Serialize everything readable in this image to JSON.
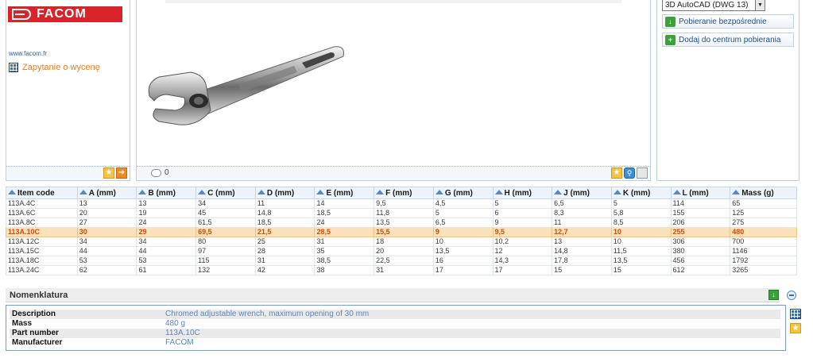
{
  "brand": {
    "logo_text": "FACOM",
    "site_link": "www.facom.fr",
    "quote_link": "Zapytanie o wycenę"
  },
  "colors": {
    "accent": "#d8232a",
    "link": "#2a5aa8",
    "quote": "#ef7c1c",
    "selected_row_bg": "#fbe2b8",
    "selected_row_text": "#d84a00",
    "value_text": "#5a87bd"
  },
  "preview": {
    "comment_count": "0"
  },
  "download": {
    "format_selected": "3D AutoCAD (DWG 13)",
    "direct_download": "Pobieranie bezpośrednie",
    "add_to_center": "Dodaj do centrum pobierania"
  },
  "table": {
    "headers": [
      "Item code",
      "A (mm)",
      "B (mm)",
      "C (mm)",
      "D (mm)",
      "E (mm)",
      "F (mm)",
      "G (mm)",
      "H (mm)",
      "J (mm)",
      "K (mm)",
      "L (mm)",
      "Mass (g)"
    ],
    "rows": [
      [
        "113A.4C",
        "13",
        "13",
        "34",
        "11",
        "14",
        "9,5",
        "4,5",
        "5",
        "6,5",
        "5",
        "114",
        "65"
      ],
      [
        "113A.6C",
        "20",
        "19",
        "45",
        "14,8",
        "18,5",
        "11,8",
        "5",
        "6",
        "8,3",
        "5,8",
        "155",
        "125"
      ],
      [
        "113A.8C",
        "27",
        "24",
        "61,5",
        "18,5",
        "24",
        "13,5",
        "6,5",
        "9",
        "11",
        "8,5",
        "206",
        "275"
      ],
      [
        "113A.10C",
        "30",
        "29",
        "69,5",
        "21,5",
        "28,5",
        "15,5",
        "9",
        "9,5",
        "12,7",
        "10",
        "255",
        "480"
      ],
      [
        "113A.12C",
        "34",
        "34",
        "80",
        "25",
        "31",
        "18",
        "10",
        "10,2",
        "13",
        "10",
        "306",
        "700"
      ],
      [
        "113A.15C",
        "44",
        "44",
        "97",
        "28",
        "35",
        "20",
        "13,5",
        "12",
        "14,8",
        "11,5",
        "380",
        "1146"
      ],
      [
        "113A.18C",
        "53",
        "53",
        "115",
        "31",
        "38,5",
        "22,5",
        "16",
        "14,3",
        "17,8",
        "13,5",
        "456",
        "1792"
      ],
      [
        "113A.24C",
        "62",
        "61",
        "132",
        "42",
        "38",
        "31",
        "17",
        "17",
        "15",
        "15",
        "612",
        "3265"
      ]
    ],
    "selected_row": 3
  },
  "nomenclature": {
    "title": "Nomenklatura",
    "rows": [
      {
        "key": "Description",
        "value": "Chromed adjustable wrench, maximum opening of 30 mm"
      },
      {
        "key": "Mass",
        "value": "480 g"
      },
      {
        "key": "Part number",
        "value": "113A.10C"
      },
      {
        "key": "Manufacturer",
        "value": "FACOM"
      }
    ]
  }
}
